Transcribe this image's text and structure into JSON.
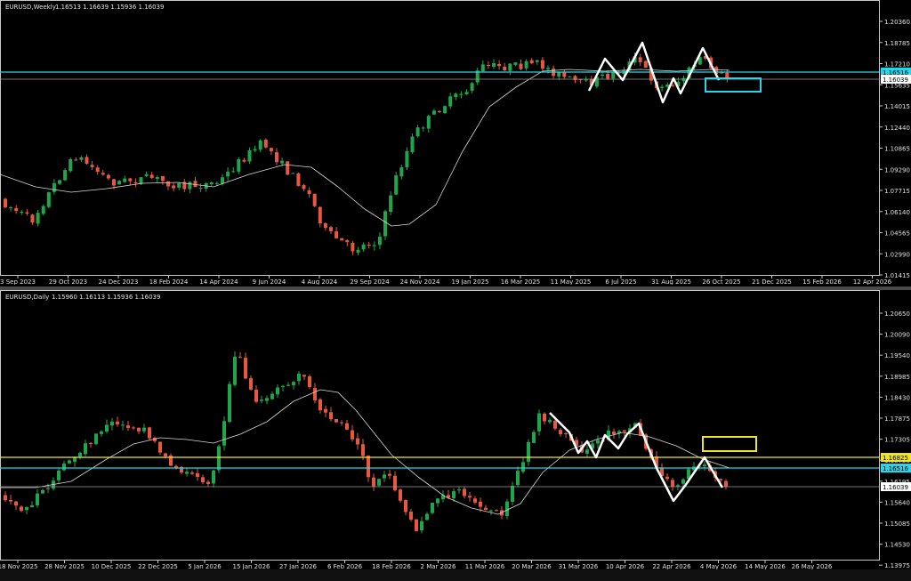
{
  "colors": {
    "background": "#000000",
    "grid_frame": "#c8c8c8",
    "bull": "#1fa64a",
    "bear": "#e8573f",
    "ma": "#d8d8d8",
    "cyan": "#27d7e8",
    "yellow": "#f0e51f",
    "pattern": "#ffffff",
    "price_tag_bg": "#ffffff"
  },
  "weekly": {
    "symbol_label": "EURUSD,Weekly",
    "ohlc": "1.16513 1.16639 1.15936 1.16039",
    "y_ticks": [
      "1.20360",
      "1.18785",
      "1.17210",
      "1.15635",
      "1.14015",
      "1.12440",
      "1.10865",
      "1.09290",
      "1.07715",
      "1.06140",
      "1.04565",
      "1.02990",
      "1.01415"
    ],
    "x_labels": [
      "3 Sep 2023",
      "29 Oct 2023",
      "24 Dec 2023",
      "18 Feb 2024",
      "14 Apr 2024",
      "9 Jun 2024",
      "4 Aug 2024",
      "29 Sep 2024",
      "24 Nov 2024",
      "19 Jan 2025",
      "16 Mar 2025",
      "11 May 2025",
      "6 Jul 2025",
      "31 Aug 2025",
      "26 Oct 2025",
      "21 Dec 2025",
      "15 Feb 2026",
      "12 Apr 2026"
    ],
    "tag_cyan": "1.16516",
    "tag_price": "1.16039"
  },
  "daily": {
    "symbol_label": "EURUSD,Daily",
    "ohlc": "1.15960 1.16113 1.15936 1.16039",
    "y_ticks": [
      "1.20650",
      "1.20090",
      "1.19540",
      "1.18985",
      "1.18430",
      "1.17875",
      "1.17305",
      "1.16750",
      "1.16195",
      "1.15640",
      "1.15085",
      "1.14530",
      "1.13975"
    ],
    "x_labels": [
      "18 Nov 2025",
      "28 Nov 2025",
      "10 Dec 2025",
      "22 Dec 2025",
      "5 Jan 2026",
      "15 Jan 2026",
      "27 Jan 2026",
      "6 Feb 2026",
      "18 Feb 2026",
      "2 Mar 2026",
      "11 Mar 2026",
      "20 Mar 2026",
      "31 Mar 2026",
      "10 Apr 2026",
      "22 Apr 2026",
      "4 May 2026",
      "14 May 2026",
      "26 May 2026"
    ],
    "tag_yellow": "1.16825",
    "tag_cyan": "1.16516",
    "tag_price": "1.16039"
  }
}
